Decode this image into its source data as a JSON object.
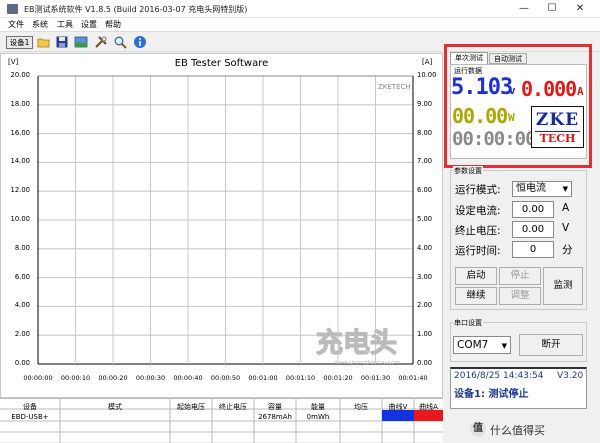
{
  "window": {
    "title": "EB测试系统软件 V1.8.5 (Build 2016-03-07 充电头网特别版)",
    "controls": [
      "—",
      "☐",
      "✕"
    ]
  },
  "menu": [
    "文件",
    "系统",
    "工具",
    "设置",
    "帮助"
  ],
  "toolbar": {
    "device_label": "设备1"
  },
  "chart": {
    "title": "EB Tester Software",
    "left_unit": "[V]",
    "right_unit": "[A]",
    "brand_label": "ZKETECH",
    "y_left_ticks": [
      "20.00",
      "18.00",
      "16.00",
      "14.00",
      "12.00",
      "10.00",
      "8.00",
      "6.00",
      "4.00",
      "2.00",
      "0.00"
    ],
    "y_right_ticks": [
      "10.00",
      "9.00",
      "8.00",
      "7.00",
      "6.00",
      "5.00",
      "4.00",
      "3.00",
      "2.00",
      "1.00",
      "0.00"
    ],
    "x_ticks": [
      "00:00:00",
      "00:00:10",
      "00:00:20",
      "00:00:30",
      "00:00:40",
      "00:00:50",
      "00:01:00",
      "00:01:10",
      "00:01:20",
      "00:01:30",
      "00:01:40"
    ]
  },
  "chart_data": {
    "type": "line",
    "title": "EB Tester Software",
    "xlabel": "",
    "ylabel": "[V]",
    "y2label": "[A]",
    "x": [
      "00:00:00",
      "00:00:10",
      "00:00:20",
      "00:00:30",
      "00:00:40",
      "00:00:50",
      "00:01:00",
      "00:01:10",
      "00:01:20",
      "00:01:30",
      "00:01:40"
    ],
    "ylim": [
      0,
      20
    ],
    "y2lim": [
      0,
      10
    ],
    "grid": true,
    "series": []
  },
  "table": {
    "headers": [
      "设备",
      "模式",
      "起始电压",
      "终止电压",
      "容量",
      "能量",
      "均压",
      "曲线V",
      "曲线A"
    ],
    "rows": [
      {
        "device": "EBD-USB+",
        "mode": "",
        "start_v": "",
        "end_v": "",
        "capacity": "2678mAh",
        "energy": "0mWh",
        "avg_v": "",
        "curve_v_color": "#1133dd",
        "curve_a_color": "#e8191e"
      }
    ]
  },
  "tabs": [
    "单次测试",
    "自动测试"
  ],
  "run": {
    "group_label": "运行数据",
    "voltage": "5.103",
    "voltage_unit": "v",
    "current": "0.000",
    "current_unit": "A",
    "power": "00.00",
    "power_unit": "W",
    "time": "00:00:00",
    "logo_top": "ZKE",
    "logo_bottom": "TECH"
  },
  "params": {
    "group_label": "参数设置",
    "mode_label": "运行模式:",
    "mode_value": "恒电流",
    "current_label": "设定电流:",
    "current_value": "0.00",
    "current_unit": "A",
    "end_v_label": "终止电压:",
    "end_v_value": "0.00",
    "end_v_unit": "V",
    "time_label": "运行时间:",
    "time_value": "0",
    "time_unit": "分",
    "start": "启动",
    "stop": "停止",
    "continue": "继续",
    "adjust": "调整",
    "monitor": "监测"
  },
  "serial": {
    "group_label": "串口设置",
    "port": "COM7",
    "disconnect": "断开"
  },
  "status": {
    "datetime": "2016/8/25 14:43:54",
    "version": "V3.20",
    "message": "设备1: 测试停止"
  },
  "watermark": {
    "main": "充电头",
    "url": "www.chongdiantou.com"
  },
  "site_badge": {
    "char": "值",
    "text": "什么值得买"
  },
  "colors": {
    "highlight": "#e03131",
    "seg_blue": "#1e2fd6",
    "seg_red": "#e01a1a",
    "seg_olive": "#a8a800",
    "seg_gray": "#8a8a8a",
    "status_blue": "#1a3a8a"
  }
}
